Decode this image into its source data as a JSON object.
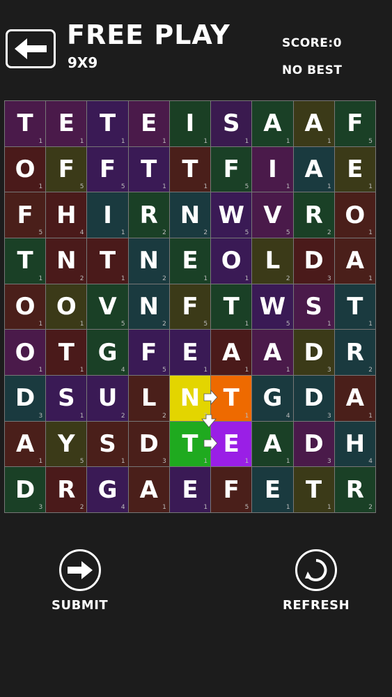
{
  "header": {
    "title": "FREE PLAY",
    "subtitle": "9X9",
    "score": "SCORE:0",
    "best": "NO BEST"
  },
  "board": {
    "rows": [
      [
        {
          "l": "T",
          "p": "1",
          "c": "#4a1a4a"
        },
        {
          "l": "E",
          "p": "1",
          "c": "#4a1a4a"
        },
        {
          "l": "T",
          "p": "1",
          "c": "#3a1a55"
        },
        {
          "l": "E",
          "p": "1",
          "c": "#4a1a4a"
        },
        {
          "l": "I",
          "p": "1",
          "c": "#1a3f24"
        },
        {
          "l": "S",
          "p": "1",
          "c": "#3a1a4f"
        },
        {
          "l": "A",
          "p": "1",
          "c": "#1a4026"
        },
        {
          "l": "A",
          "p": "1",
          "c": "#3b3a18"
        },
        {
          "l": "F",
          "p": "5",
          "c": "#1a4026"
        }
      ],
      [
        {
          "l": "O",
          "p": "1",
          "c": "#4a1a1a"
        },
        {
          "l": "F",
          "p": "5",
          "c": "#3b3a18"
        },
        {
          "l": "F",
          "p": "5",
          "c": "#3a1a55"
        },
        {
          "l": "T",
          "p": "1",
          "c": "#3a1a55"
        },
        {
          "l": "T",
          "p": "1",
          "c": "#4a1f1a"
        },
        {
          "l": "F",
          "p": "5",
          "c": "#1a4026"
        },
        {
          "l": "I",
          "p": "1",
          "c": "#4a1a4a"
        },
        {
          "l": "A",
          "p": "1",
          "c": "#1a3a3f"
        },
        {
          "l": "E",
          "p": "1",
          "c": "#3b3a18"
        }
      ],
      [
        {
          "l": "F",
          "p": "5",
          "c": "#4a1f1a"
        },
        {
          "l": "H",
          "p": "4",
          "c": "#4a1a1a"
        },
        {
          "l": "I",
          "p": "1",
          "c": "#1a3a3f"
        },
        {
          "l": "R",
          "p": "2",
          "c": "#1a4026"
        },
        {
          "l": "N",
          "p": "2",
          "c": "#1a3a3f"
        },
        {
          "l": "W",
          "p": "5",
          "c": "#3a1a55"
        },
        {
          "l": "V",
          "p": "5",
          "c": "#4a1a4a"
        },
        {
          "l": "R",
          "p": "2",
          "c": "#1a4026"
        },
        {
          "l": "O",
          "p": "1",
          "c": "#4a1f1a"
        }
      ],
      [
        {
          "l": "T",
          "p": "1",
          "c": "#1a4026"
        },
        {
          "l": "N",
          "p": "2",
          "c": "#4a1a1a"
        },
        {
          "l": "T",
          "p": "1",
          "c": "#4a1a1a"
        },
        {
          "l": "N",
          "p": "2",
          "c": "#1a3a3f"
        },
        {
          "l": "E",
          "p": "1",
          "c": "#1a4026"
        },
        {
          "l": "O",
          "p": "1",
          "c": "#3a1a55"
        },
        {
          "l": "L",
          "p": "2",
          "c": "#3b3a18"
        },
        {
          "l": "D",
          "p": "3",
          "c": "#4a1a1a"
        },
        {
          "l": "A",
          "p": "1",
          "c": "#4a1f1a"
        }
      ],
      [
        {
          "l": "O",
          "p": "1",
          "c": "#4a1f1a"
        },
        {
          "l": "O",
          "p": "1",
          "c": "#3b3a18"
        },
        {
          "l": "V",
          "p": "5",
          "c": "#1a4026"
        },
        {
          "l": "N",
          "p": "2",
          "c": "#1a3a3f"
        },
        {
          "l": "F",
          "p": "5",
          "c": "#3b3a18"
        },
        {
          "l": "T",
          "p": "1",
          "c": "#1a4026"
        },
        {
          "l": "W",
          "p": "5",
          "c": "#3a1a55"
        },
        {
          "l": "S",
          "p": "1",
          "c": "#4a1a4a"
        },
        {
          "l": "T",
          "p": "1",
          "c": "#1a3a3f"
        }
      ],
      [
        {
          "l": "O",
          "p": "1",
          "c": "#4a1a4a"
        },
        {
          "l": "T",
          "p": "1",
          "c": "#4a1a1a"
        },
        {
          "l": "G",
          "p": "4",
          "c": "#1a4026"
        },
        {
          "l": "F",
          "p": "5",
          "c": "#3a1a55"
        },
        {
          "l": "E",
          "p": "1",
          "c": "#3a1a55"
        },
        {
          "l": "A",
          "p": "1",
          "c": "#4a1a1a"
        },
        {
          "l": "A",
          "p": "1",
          "c": "#4a1a4a"
        },
        {
          "l": "D",
          "p": "3",
          "c": "#3b3a18"
        },
        {
          "l": "R",
          "p": "2",
          "c": "#1a3a3f"
        }
      ],
      [
        {
          "l": "D",
          "p": "3",
          "c": "#1a3a3f"
        },
        {
          "l": "S",
          "p": "1",
          "c": "#3a1a55"
        },
        {
          "l": "U",
          "p": "2",
          "c": "#3a1a55"
        },
        {
          "l": "L",
          "p": "2",
          "c": "#4a1f1a"
        },
        {
          "l": "N",
          "p": "2",
          "c": "#e3d500"
        },
        {
          "l": "T",
          "p": "1",
          "c": "#ee6a00"
        },
        {
          "l": "G",
          "p": "4",
          "c": "#1a3a3f"
        },
        {
          "l": "D",
          "p": "3",
          "c": "#1a3a3f"
        },
        {
          "l": "A",
          "p": "1",
          "c": "#4a1f1a"
        }
      ],
      [
        {
          "l": "A",
          "p": "1",
          "c": "#4a1f1a"
        },
        {
          "l": "Y",
          "p": "5",
          "c": "#3b3a18"
        },
        {
          "l": "S",
          "p": "1",
          "c": "#4a1f1a"
        },
        {
          "l": "D",
          "p": "3",
          "c": "#4a1f1a"
        },
        {
          "l": "T",
          "p": "1",
          "c": "#1faa1f"
        },
        {
          "l": "E",
          "p": "1",
          "c": "#9a1fe6"
        },
        {
          "l": "A",
          "p": "1",
          "c": "#1a4026"
        },
        {
          "l": "D",
          "p": "3",
          "c": "#4a1a4a"
        },
        {
          "l": "H",
          "p": "4",
          "c": "#1a3a3f"
        }
      ],
      [
        {
          "l": "D",
          "p": "3",
          "c": "#1a4026"
        },
        {
          "l": "R",
          "p": "2",
          "c": "#4a1a1a"
        },
        {
          "l": "G",
          "p": "4",
          "c": "#3a1a55"
        },
        {
          "l": "A",
          "p": "1",
          "c": "#4a1f1a"
        },
        {
          "l": "E",
          "p": "1",
          "c": "#3a1a55"
        },
        {
          "l": "F",
          "p": "5",
          "c": "#4a1f1a"
        },
        {
          "l": "E",
          "p": "1",
          "c": "#1a3a3f"
        },
        {
          "l": "T",
          "p": "1",
          "c": "#3b3a18"
        },
        {
          "l": "R",
          "p": "2",
          "c": "#1a4026"
        }
      ]
    ]
  },
  "actions": {
    "submit": "SUBMIT",
    "refresh": "REFRESH"
  },
  "icons": {
    "back": "arrow-left-icon",
    "submit": "arrow-right-circle-icon",
    "refresh": "refresh-icon",
    "path": "path-arrow-icon"
  }
}
